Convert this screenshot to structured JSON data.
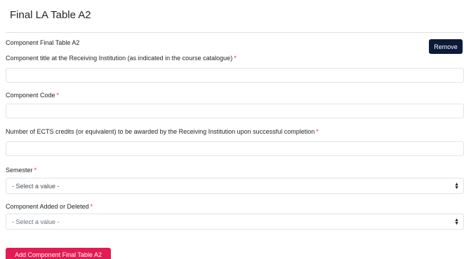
{
  "page": {
    "title": "Final LA Table A2"
  },
  "component": {
    "title": "Component Final Table A2",
    "remove_label": "Remove"
  },
  "fields": {
    "course_title": {
      "label": "Component title at the Receiving Institution (as indicated in the course catalogue)",
      "required_mark": "*",
      "value": ""
    },
    "code": {
      "label": "Component Code",
      "required_mark": "*",
      "value": ""
    },
    "ects": {
      "label": "Number of ECTS credits (or equivalent) to be awarded by the Receiving Institution upon successful completion",
      "required_mark": "*",
      "value": ""
    },
    "semester": {
      "label": "Semester",
      "required_mark": "*",
      "selected": "- Select a value -"
    },
    "added_deleted": {
      "label": "Component Added or Deleted",
      "required_mark": "*",
      "selected": "- Select a value -"
    }
  },
  "actions": {
    "add_label": "Add Component Final Table A2"
  },
  "colors": {
    "remove_button": "#0c1a3a",
    "add_button": "#e31b54",
    "required": "#dc3545"
  }
}
